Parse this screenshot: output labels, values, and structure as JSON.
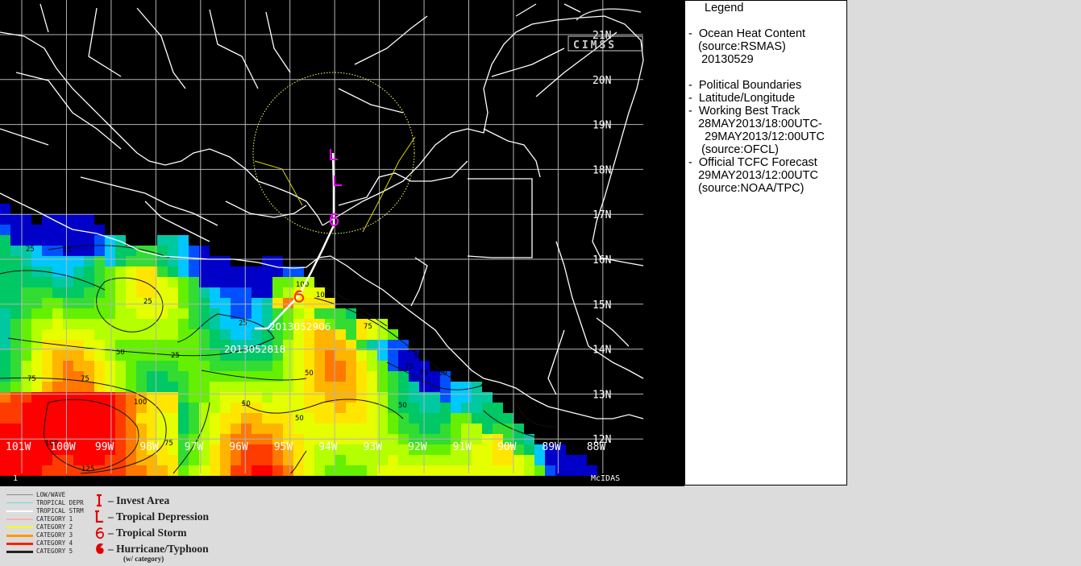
{
  "map": {
    "frame_number": "1",
    "system_label": "McIDAS",
    "logo_text": "CIMSS",
    "lon_labels": [
      "101W",
      "100W",
      "99W",
      "98W",
      "97W",
      "96W",
      "95W",
      "94W",
      "93W",
      "92W",
      "91W",
      "90W",
      "89W",
      "88W"
    ],
    "lat_labels": [
      "21N",
      "20N",
      "19N",
      "18N",
      "17N",
      "16N",
      "15N",
      "14N",
      "13N",
      "12N"
    ],
    "track_labels": {
      "start": "2013052818",
      "end": "2013052906"
    },
    "contour_labels": [
      "25",
      "25",
      "25",
      "25",
      "25",
      "25",
      "25",
      "25",
      "50",
      "50",
      "50",
      "50",
      "50",
      "50",
      "50",
      "50",
      "50",
      "50",
      "75",
      "75",
      "75",
      "75",
      "75",
      "75",
      "100",
      "100",
      "100",
      "100",
      "100",
      "125"
    ],
    "colors": {
      "background": "#000000",
      "boundary": "#ffffff",
      "grid": "#b4b4b4",
      "best_track": "#ffffff",
      "forecast_track": "#ffffff",
      "forecast_symbol": "#ff00ff",
      "storm_symbol": "#ff3300",
      "cone": "#ffff66",
      "ohc_scale": [
        "#0000c8",
        "#0050ff",
        "#00c8ff",
        "#00c8a0",
        "#00c864",
        "#32dc32",
        "#64f000",
        "#b4ff00",
        "#e6ff00",
        "#ffe600",
        "#ffb400",
        "#ff7800",
        "#ff3c00",
        "#ff0000"
      ]
    }
  },
  "legend": {
    "title": "Legend",
    "lines": [
      "-  Ocean Heat Content",
      "   (source:RSMAS)",
      "    20130529",
      "",
      "-  Political Boundaries",
      "-  Latitude/Longitude",
      "-  Working Best Track",
      "   28MAY2013/18:00UTC-",
      "     29MAY2013/12:00UTC",
      "    (source:OFCL)",
      "-  Official TCFC Forecast",
      "   29MAY2013/12:00UTC",
      "   (source:NOAA/TPC)"
    ]
  },
  "key": {
    "lines": [
      {
        "label": "LOW/WAVE",
        "color": "#888888"
      },
      {
        "label": "TROPICAL DEPR",
        "color": "#6fd8d8"
      },
      {
        "label": "TROPICAL STRM",
        "color": "#ffffff"
      },
      {
        "label": "CATEGORY 1",
        "color": "#ffb0b0"
      },
      {
        "label": "CATEGORY 2",
        "color": "#ffff00"
      },
      {
        "label": "CATEGORY 3",
        "color": "#ff9900"
      },
      {
        "label": "CATEGORY 4",
        "color": "#ff2000"
      },
      {
        "label": "CATEGORY 5",
        "color": "#222222"
      }
    ],
    "symbols": [
      {
        "label": "– Invest Area",
        "icon": "invest-icon"
      },
      {
        "label": "– Tropical Depression",
        "icon": "depression-icon"
      },
      {
        "label": "– Tropical Storm",
        "icon": "storm-icon"
      },
      {
        "label": "– Hurricane/Typhoon",
        "icon": "hurricane-icon"
      }
    ],
    "symbol_note": "(w/ category)"
  }
}
